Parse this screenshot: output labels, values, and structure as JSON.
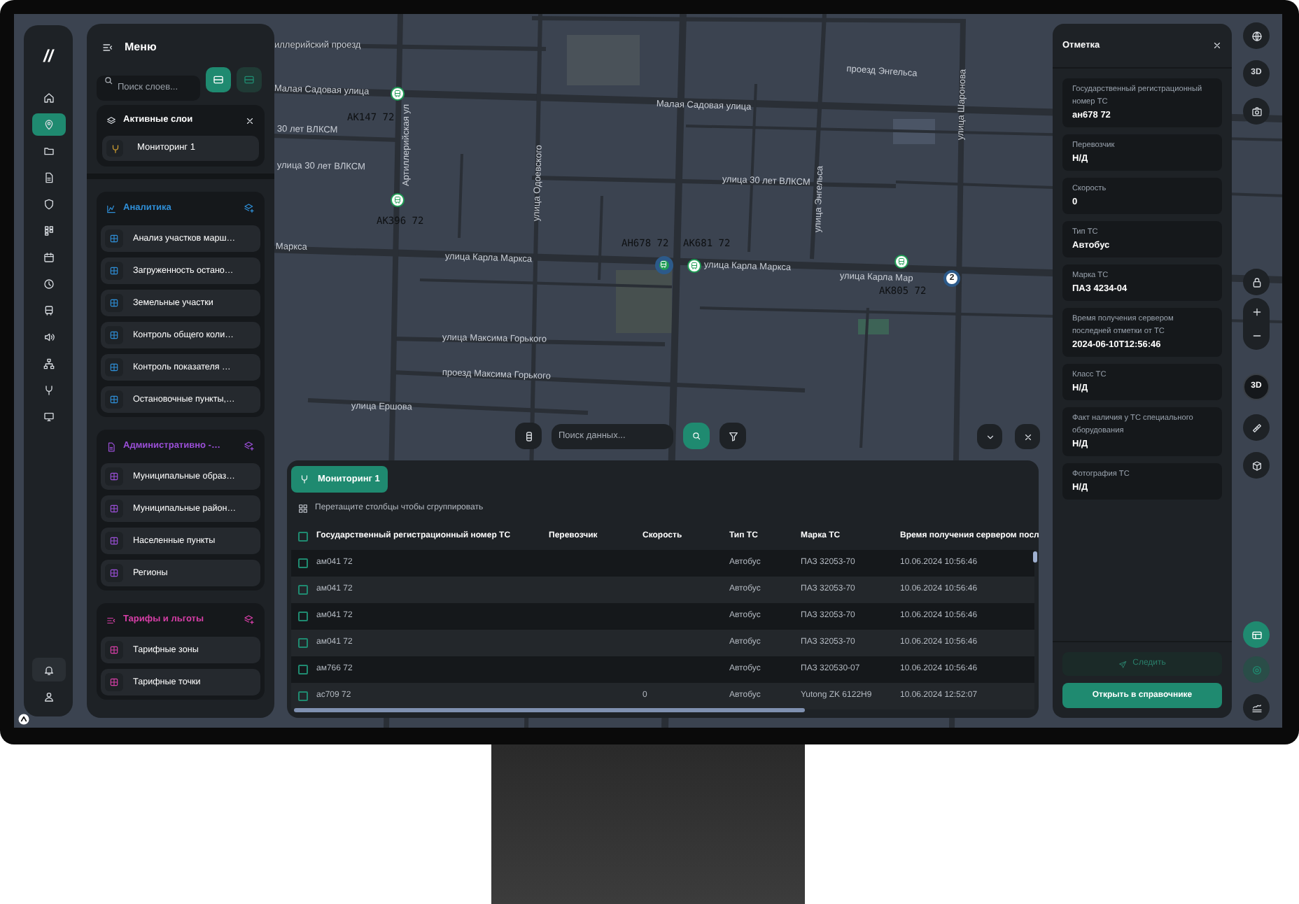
{
  "rail": {
    "logo": "//",
    "items": [
      {
        "selected": false
      },
      {
        "selected": true
      },
      {
        "selected": false
      },
      {
        "selected": false
      },
      {
        "selected": false
      },
      {
        "selected": false
      },
      {
        "selected": false
      },
      {
        "selected": false
      },
      {
        "selected": false
      },
      {
        "selected": false
      },
      {
        "selected": false
      },
      {
        "selected": false
      },
      {
        "selected": false
      }
    ],
    "bottom_items": [
      {
        "selected": true
      },
      {
        "selected": false
      }
    ]
  },
  "menu": {
    "title": "Меню",
    "search": {
      "placeholder": "Поиск слоев..."
    },
    "view_buttons": [
      {
        "selected": true
      },
      {
        "selected": false
      }
    ],
    "active_layers": {
      "title": "Активные слои",
      "items": [
        {
          "label": "Мониторинг 1"
        }
      ]
    },
    "groups": [
      {
        "title": "Аналитика",
        "color": "#2f8fd8",
        "items": [
          "Анализ участков марш…",
          "Загруженность остано…",
          "Земельные участки",
          "Контроль общего коли…",
          "Контроль показателя …",
          "Остановочные пункты,…"
        ]
      },
      {
        "title": "Административно -…",
        "color": "#9b4fd8",
        "items": [
          "Муниципальные образ…",
          "Муниципальные район…",
          "Населенные пункты",
          "Регионы"
        ]
      },
      {
        "title": "Тарифы и льготы",
        "color": "#d83fa8",
        "items": [
          "Тарифные зоны",
          "Тарифные точки"
        ]
      }
    ]
  },
  "map": {
    "street_labels": [
      "иллерийский проезд",
      "Малая Садовая улица",
      "Малая Садовая улица",
      "проезд Энгельса",
      "30 лет ВЛКСМ",
      "улица 30 лет ВЛКСМ",
      "улица 30 лет ВЛКСМ",
      "Артиллерийская ул",
      "улица Одоевского",
      "улица Энгельса",
      "улица Шаронова",
      "Маркса",
      "улица Карла Маркса",
      "улица Карла Маркса",
      "улица Карла Мар",
      "улица Максима Горького",
      "проезд Максима Горького",
      "улица Ершова"
    ],
    "vehicle_labels": [
      "АК147 72",
      "АК396 72",
      "АН678 72",
      "АК681 72",
      "АК805 72"
    ],
    "markers": [
      {
        "selected": false
      },
      {
        "selected": false
      },
      {
        "selected": true
      },
      {
        "selected": false
      },
      {
        "selected": false
      }
    ],
    "cluster": {
      "count": "2"
    },
    "search": {
      "placeholder": "Поиск данных..."
    }
  },
  "map_controls": {
    "tilt_label": "3D",
    "compass_label": "3D"
  },
  "table": {
    "select_all": {
      "checked": false
    },
    "tab": {
      "label": "Мониторинг 1",
      "selected": true
    },
    "group_hint": "Перетащите столбцы чтобы сгруппировать",
    "columns": [
      "Государственный регистрационный номер ТС",
      "Перевозчик",
      "Скорость",
      "Тип ТС",
      "Марка ТС",
      "Время получения сервером посл"
    ],
    "rows": [
      {
        "checked": false,
        "plate": "ам041 72",
        "type": "Автобус",
        "brand": "ПАЗ 32053-70",
        "time": "10.06.2024 10:56:46"
      },
      {
        "checked": false,
        "plate": "ам041 72",
        "type": "Автобус",
        "brand": "ПАЗ 32053-70",
        "time": "10.06.2024 10:56:46"
      },
      {
        "checked": false,
        "plate": "ам041 72",
        "type": "Автобус",
        "brand": "ПАЗ 32053-70",
        "time": "10.06.2024 10:56:46"
      },
      {
        "checked": false,
        "plate": "ам041 72",
        "type": "Автобус",
        "brand": "ПАЗ 32053-70",
        "time": "10.06.2024 10:56:46"
      },
      {
        "checked": false,
        "plate": "ам766 72",
        "type": "Автобус",
        "brand": "ПАЗ 320530-07",
        "time": "10.06.2024 10:56:46"
      },
      {
        "checked": false,
        "plate": "ас709 72",
        "speed": "0",
        "type": "Автобус",
        "brand": "Yutong ZK 6122H9",
        "time": "10.06.2024 12:52:07"
      }
    ]
  },
  "details": {
    "title": "Отметка",
    "fields": [
      {
        "label": "Государственный регистрационный номер ТС",
        "value": "ан678 72"
      },
      {
        "label": "Перевозчик",
        "value": "Н/Д"
      },
      {
        "label": "Скорость",
        "value": "0"
      },
      {
        "label": "Тип ТС",
        "value": "Автобус"
      },
      {
        "label": "Марка ТС",
        "value": "ПАЗ 4234-04"
      },
      {
        "label": "Время получения сервером последней отметки от ТС",
        "value": "2024-06-10T12:56:46"
      },
      {
        "label": "Класс ТС",
        "value": "Н/Д"
      },
      {
        "label": "Факт наличия у ТС специального оборудования",
        "value": "Н/Д"
      },
      {
        "label": "Фотография ТС",
        "value": "Н/Д"
      }
    ],
    "follow_button": {
      "label": "Следить",
      "disabled": true
    },
    "open_button": {
      "label": "Открыть в справочнике"
    }
  }
}
